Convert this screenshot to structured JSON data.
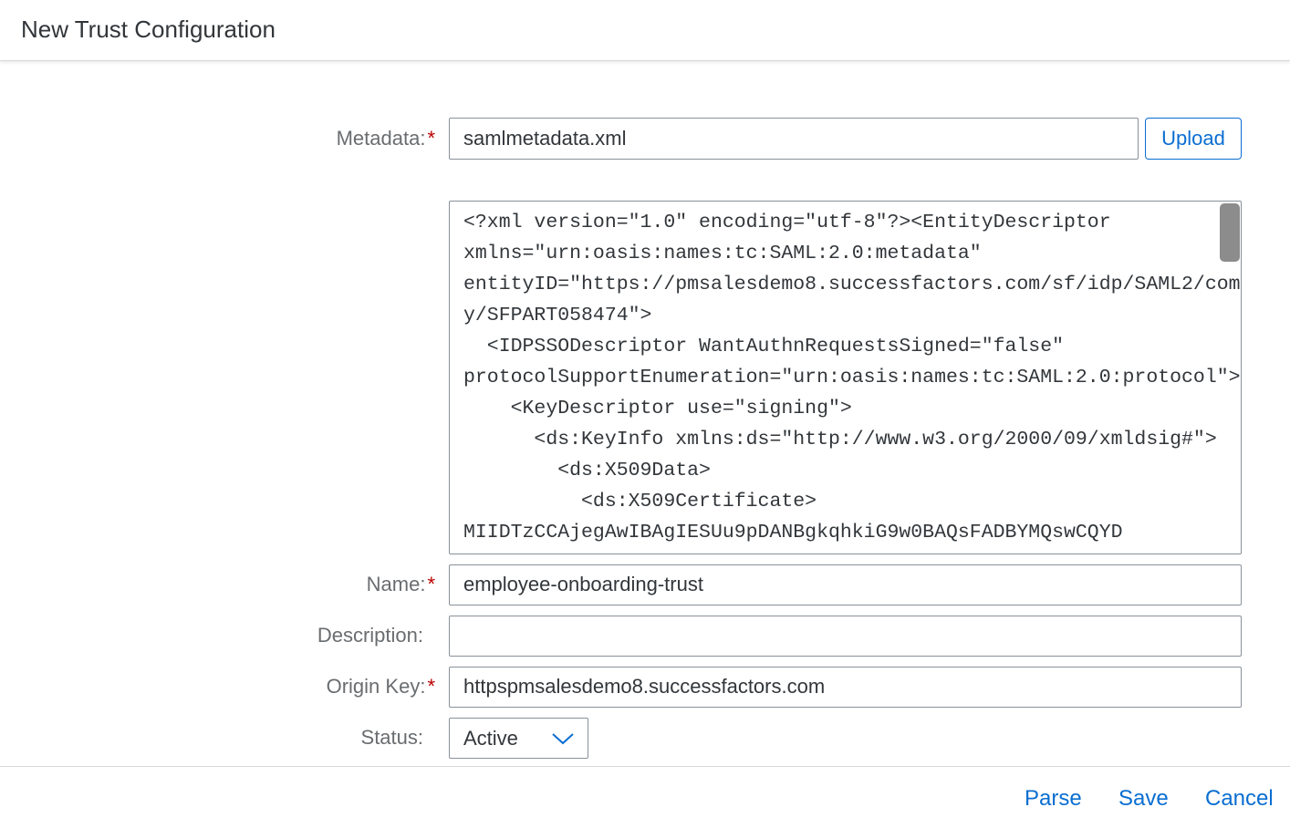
{
  "dialog": {
    "title": "New Trust Configuration"
  },
  "metadata": {
    "label": "Metadata:",
    "required_mark": "*",
    "value": "samlmetadata.xml",
    "upload_label": "Upload",
    "xml_content": "<?xml version=\"1.0\" encoding=\"utf-8\"?><EntityDescriptor\nxmlns=\"urn:oasis:names:tc:SAML:2.0:metadata\"\nentityID=\"https://pmsalesdemo8.successfactors.com/sf/idp/SAML2/compan\ny/SFPART058474\">\n  <IDPSSODescriptor WantAuthnRequestsSigned=\"false\"\nprotocolSupportEnumeration=\"urn:oasis:names:tc:SAML:2.0:protocol\">\n    <KeyDescriptor use=\"signing\">\n      <ds:KeyInfo xmlns:ds=\"http://www.w3.org/2000/09/xmldsig#\">\n        <ds:X509Data>\n          <ds:X509Certificate>\nMIIDTzCCAjegAwIBAgIESUu9pDANBgkqhkiG9w0BAQsFADBYMQswCQYD"
  },
  "name": {
    "label": "Name:",
    "required_mark": "*",
    "value": "employee-onboarding-trust"
  },
  "description": {
    "label": "Description:",
    "value": ""
  },
  "origin_key": {
    "label": "Origin Key:",
    "required_mark": "*",
    "value": "httpspmsalesdemo8.successfactors.com"
  },
  "status": {
    "label": "Status:",
    "value": "Active",
    "icon": "chevron-down-icon"
  },
  "footer": {
    "parse_label": "Parse",
    "save_label": "Save",
    "cancel_label": "Cancel"
  },
  "colors": {
    "accent": "#0a6ed1",
    "required": "#bb0000",
    "label": "#6a6d70",
    "text": "#32363a",
    "border": "#89919a"
  }
}
